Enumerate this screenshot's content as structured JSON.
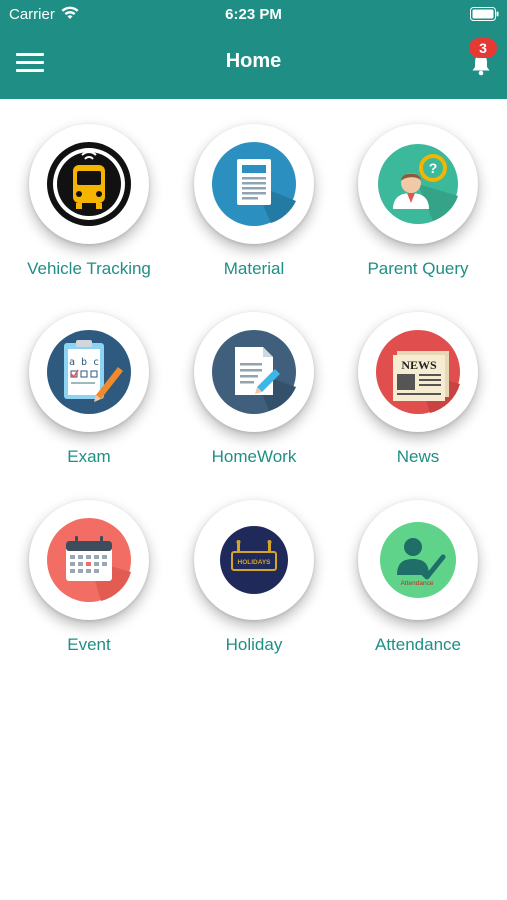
{
  "status_bar": {
    "carrier": "Carrier",
    "time": "6:23 PM"
  },
  "nav": {
    "title": "Home",
    "notification_count": "3"
  },
  "colors": {
    "header": "#1f8f85",
    "label": "#1f8f85",
    "badge": "#e53935"
  },
  "menu": [
    {
      "label": "Vehicle Tracking",
      "icon": "bus-icon"
    },
    {
      "label": "Material",
      "icon": "document-icon"
    },
    {
      "label": "Parent Query",
      "icon": "parent-query-icon"
    },
    {
      "label": "Exam",
      "icon": "exam-clipboard-icon"
    },
    {
      "label": "HomeWork",
      "icon": "homework-icon"
    },
    {
      "label": "News",
      "icon": "newspaper-icon"
    },
    {
      "label": "Event",
      "icon": "calendar-icon"
    },
    {
      "label": "Holiday",
      "icon": "holiday-sign-icon"
    },
    {
      "label": "Attendance",
      "icon": "attendance-icon"
    }
  ],
  "icon_text": {
    "news": "NEWS",
    "holidays": "HOLIDAYS",
    "attendance": "Attendance",
    "exam_letters": "a b c"
  }
}
